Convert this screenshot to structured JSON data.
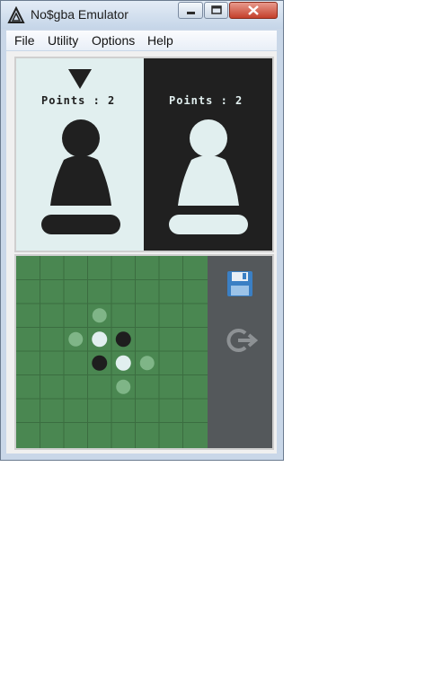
{
  "window": {
    "title": "No$gba Emulator"
  },
  "menu": [
    "File",
    "Utility",
    "Options",
    "Help"
  ],
  "players": [
    {
      "points_label": "Points : 2",
      "piece": "black",
      "active": true
    },
    {
      "points_label": "Points : 2",
      "piece": "white",
      "active": false
    }
  ],
  "board": {
    "size": 8,
    "pieces": [
      {
        "row": 3,
        "col": 3,
        "color": "white"
      },
      {
        "row": 3,
        "col": 4,
        "color": "black"
      },
      {
        "row": 4,
        "col": 3,
        "color": "black"
      },
      {
        "row": 4,
        "col": 4,
        "color": "white"
      }
    ],
    "hints": [
      {
        "row": 2,
        "col": 3
      },
      {
        "row": 3,
        "col": 2
      },
      {
        "row": 4,
        "col": 5
      },
      {
        "row": 5,
        "col": 4
      }
    ]
  },
  "colors": {
    "board_green": "#4a8751",
    "grid_line": "#3b6d40",
    "black_piece": "#1e1e1e",
    "white_piece": "#e1efef",
    "hint": "#7fb587",
    "panel_light": "#e1efef",
    "panel_dark": "#202020",
    "side_panel": "#54585b"
  },
  "icons": {
    "save": "floppy-disk-icon",
    "exit": "exit-arrow-icon"
  }
}
